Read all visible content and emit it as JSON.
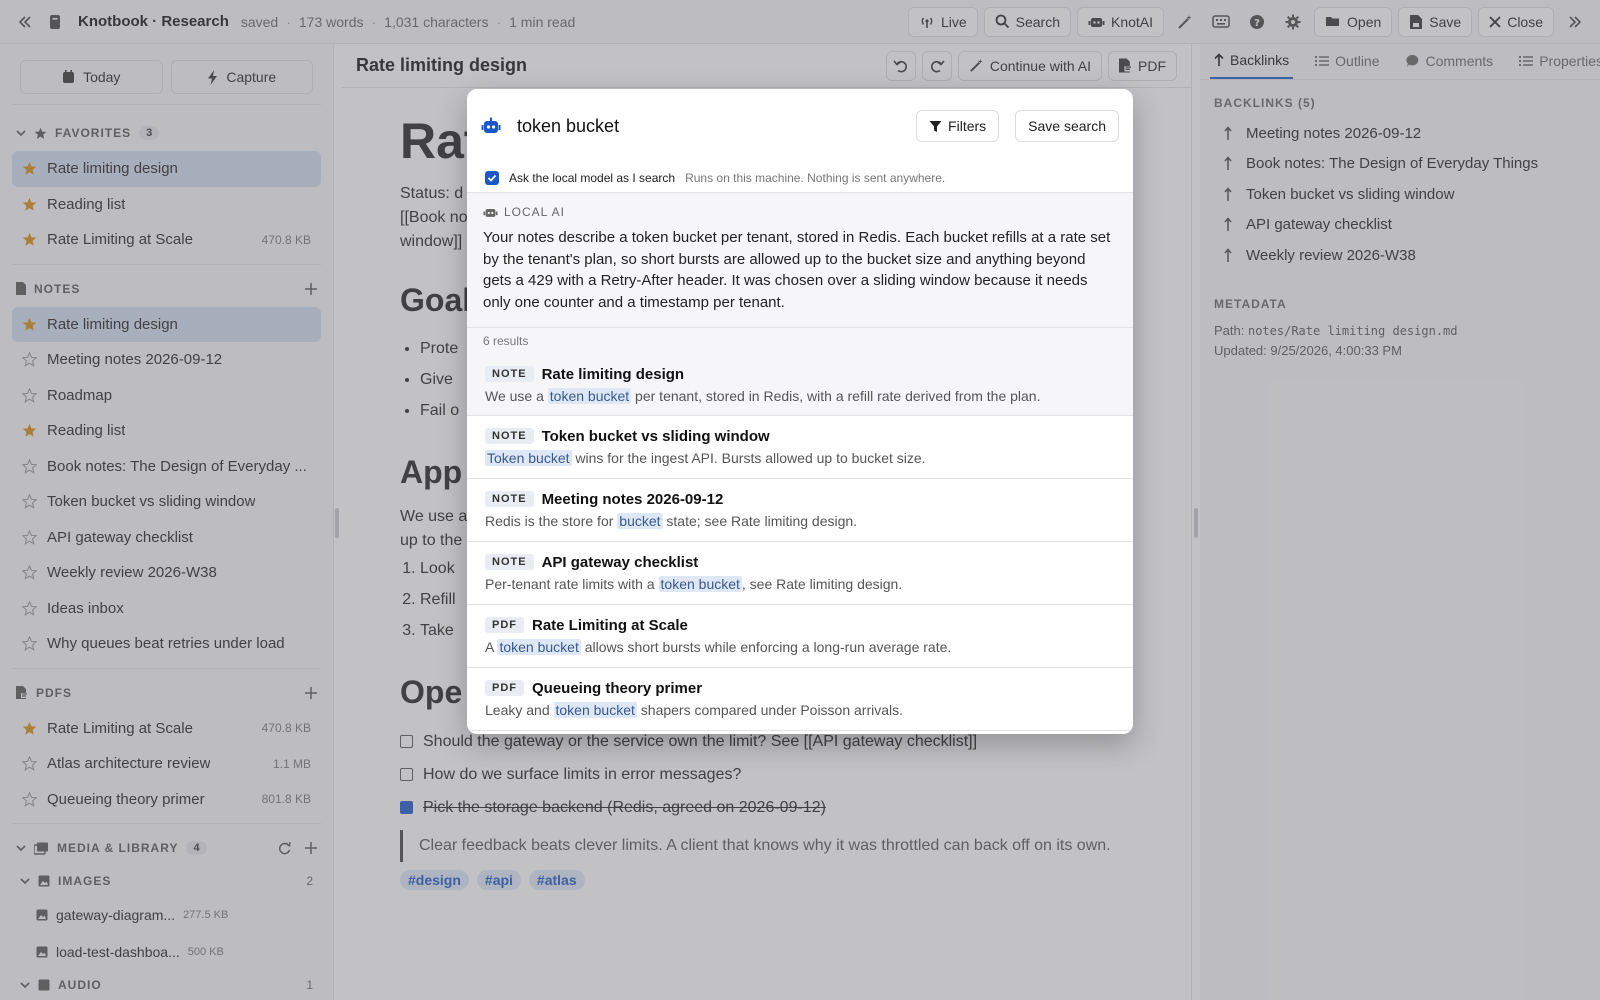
{
  "topbar": {
    "title": "Knotbook · Research",
    "status": [
      "saved",
      "173 words",
      "1,031 characters",
      "1 min read"
    ],
    "buttons": {
      "live": "Live",
      "search": "Search",
      "knotai": "KnotAI",
      "open": "Open",
      "save": "Save",
      "close": "Close"
    }
  },
  "sidebar": {
    "today": "Today",
    "capture": "Capture",
    "favorites": {
      "title": "FAVORITES",
      "count": "3",
      "items": [
        {
          "label": "Rate limiting design",
          "size": ""
        },
        {
          "label": "Reading list",
          "size": ""
        },
        {
          "label": "Rate Limiting at Scale",
          "size": "470.8 KB"
        }
      ]
    },
    "notes": {
      "title": "NOTES",
      "items": [
        {
          "label": "Rate limiting design"
        },
        {
          "label": "Meeting notes 2026-09-12"
        },
        {
          "label": "Roadmap"
        },
        {
          "label": "Reading list"
        },
        {
          "label": "Book notes: The Design of Everyday ..."
        },
        {
          "label": "Token bucket vs sliding window"
        },
        {
          "label": "API gateway checklist"
        },
        {
          "label": "Weekly review 2026-W38"
        },
        {
          "label": "Ideas inbox"
        },
        {
          "label": "Why queues beat retries under load"
        }
      ]
    },
    "pdfs": {
      "title": "PDFS",
      "items": [
        {
          "label": "Rate Limiting at Scale",
          "size": "470.8 KB"
        },
        {
          "label": "Atlas architecture review",
          "size": "1.1 MB"
        },
        {
          "label": "Queueing theory primer",
          "size": "801.8 KB"
        }
      ]
    },
    "media": {
      "title": "MEDIA & LIBRARY",
      "count": "4",
      "images_title": "IMAGES",
      "images_count": "2",
      "files": [
        {
          "label": "gateway-diagram...",
          "size": "277.5 KB"
        },
        {
          "label": "load-test-dashboa...",
          "size": "500 KB"
        }
      ],
      "audio_title": "AUDIO",
      "audio_count": "1"
    }
  },
  "editor": {
    "title": "Rate limiting design",
    "continue_ai": "Continue with AI",
    "pdf": "PDF",
    "h1": "Rat",
    "status_line1": "Status: d",
    "status_line2": "[[Book no",
    "status_line3": "window]]",
    "goal_heading": "Goal",
    "goal_items": [
      "Prote",
      "Give",
      "Fail o"
    ],
    "approach_heading": "App",
    "approach_p1": "We use a",
    "approach_p2": "up to the",
    "steps": [
      "Look",
      "Refill",
      "Take"
    ],
    "open_heading": "Ope",
    "checks": [
      {
        "text": "Should the gateway or the service own the limit? See [[API gateway checklist]]",
        "done": false
      },
      {
        "text": "How do we surface limits in error messages?",
        "done": false
      },
      {
        "text": "Pick the storage backend (Redis, agreed on 2026-09-12)",
        "done": true
      }
    ],
    "quote": "Clear feedback beats clever limits. A client that knows why it was throttled can back off on its own.",
    "tags": [
      "#design",
      "#api",
      "#atlas"
    ]
  },
  "rightpanel": {
    "tabs": [
      "Backlinks",
      "Outline",
      "Comments",
      "Properties"
    ],
    "backlinks_title": "BACKLINKS (5)",
    "backlinks": [
      "Meeting notes 2026-09-12",
      "Book notes: The Design of Everyday Things",
      "Token bucket vs sliding window",
      "API gateway checklist",
      "Weekly review 2026-W38"
    ],
    "metadata_title": "METADATA",
    "path_label": "Path:",
    "path_value": "notes/Rate limiting design.md",
    "updated": "Updated: 9/25/2026, 4:00:33 PM"
  },
  "modal": {
    "query": "token bucket",
    "filters": "Filters",
    "save_search": "Save search",
    "ask_label": "Ask the local model as I search",
    "ask_hint": "Runs on this machine. Nothing is sent anywhere.",
    "ai_header": "LOCAL AI",
    "ai_answer": "Your notes describe a token bucket per tenant, stored in Redis. Each bucket refills at a rate set by the tenant's plan, so short bursts are allowed up to the bucket size and anything beyond gets a 429 with a Retry-After header. It was chosen over a sliding window because it needs only one counter and a timestamp per tenant.",
    "result_count": "6 results",
    "results": [
      {
        "kind": "NOTE",
        "title": "Rate limiting design",
        "pre": "We use a ",
        "hit": "token bucket",
        "post": " per tenant, stored in Redis, with a refill rate derived from the plan."
      },
      {
        "kind": "NOTE",
        "title": "Token bucket vs sliding window",
        "pre": "",
        "hit": "Token bucket",
        "post": " wins for the ingest API. Bursts allowed up to bucket size."
      },
      {
        "kind": "NOTE",
        "title": "Meeting notes 2026-09-12",
        "pre": "Redis is the store for ",
        "hit": "bucket",
        "post": " state; see Rate limiting design."
      },
      {
        "kind": "NOTE",
        "title": "API gateway checklist",
        "pre": "Per-tenant rate limits with a ",
        "hit": "token bucket",
        "post": ", see Rate limiting design."
      },
      {
        "kind": "PDF",
        "title": "Rate Limiting at Scale",
        "pre": "A ",
        "hit": "token bucket",
        "post": " allows short bursts while enforcing a long-run average rate."
      },
      {
        "kind": "PDF",
        "title": "Queueing theory primer",
        "pre": "Leaky and ",
        "hit": "token bucket",
        "post": " shapers compared under Poisson arrivals."
      }
    ]
  },
  "colors": {
    "accent": "#1a57c7",
    "favorite_star": "#d98b0f",
    "active_item": "#d2deef"
  },
  "icons": {
    "star": "star-icon",
    "search": "search-icon",
    "robot": "robot-icon",
    "filter": "filter-icon"
  }
}
